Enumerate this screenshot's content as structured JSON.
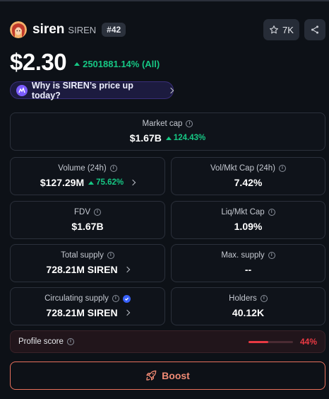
{
  "token": {
    "name": "siren",
    "symbol": "SIREN",
    "rank": "#42",
    "watchlist_count": "7K"
  },
  "price": {
    "value": "$2.30",
    "change": "2501881.14% (All)"
  },
  "why_pill": "Why is SIREN’s price up today?",
  "stats": {
    "market_cap": {
      "label": "Market cap",
      "value": "$1.67B",
      "change": "124.43%"
    },
    "volume": {
      "label": "Volume (24h)",
      "value": "$127.29M",
      "change": "75.62%"
    },
    "vol_mkt_cap": {
      "label": "Vol/Mkt Cap (24h)",
      "value": "7.42%"
    },
    "fdv": {
      "label": "FDV",
      "value": "$1.67B"
    },
    "liq_mkt_cap": {
      "label": "Liq/Mkt Cap",
      "value": "1.09%"
    },
    "total_supply": {
      "label": "Total supply",
      "value": "728.21M SIREN"
    },
    "max_supply": {
      "label": "Max. supply",
      "value": "--"
    },
    "circulating_supply": {
      "label": "Circulating supply",
      "value": "728.21M SIREN"
    },
    "holders": {
      "label": "Holders",
      "value": "40.12K"
    }
  },
  "profile_score": {
    "label": "Profile score",
    "value": "44%",
    "fraction": 0.44
  },
  "boost_label": "Boost",
  "colors": {
    "up": "#16c784",
    "down": "#ea3943",
    "boost": "#f08a74",
    "accent": "#3861fb"
  }
}
